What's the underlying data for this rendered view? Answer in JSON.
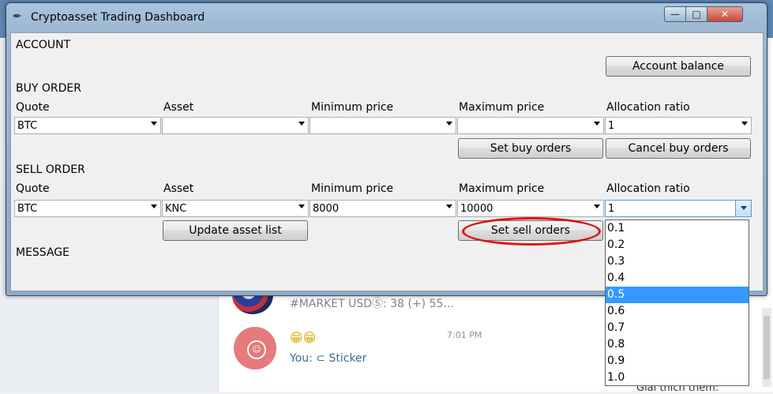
{
  "background": {
    "chat_preview": "#MARKET USDⓈ: 38 (+) 55...",
    "emoji": "😁😁",
    "time": "7:01 PM",
    "you_text": "You: ⊂ Sticker",
    "right_text": "Giai thich them:"
  },
  "window": {
    "title": "Cryptoasset Trading Dashboard",
    "controls": {
      "minimize": "—",
      "maximize": "□",
      "close": "✕"
    }
  },
  "account": {
    "heading": "ACCOUNT",
    "balance_button": "Account balance"
  },
  "buy": {
    "heading": "BUY ORDER",
    "labels": {
      "quote": "Quote",
      "asset": "Asset",
      "min": "Minimum price",
      "max": "Maximum price",
      "ratio": "Allocation ratio"
    },
    "values": {
      "quote": "BTC",
      "asset": "",
      "min": "",
      "max": "",
      "ratio": "1"
    },
    "set_button": "Set buy orders",
    "cancel_button": "Cancel buy orders"
  },
  "sell": {
    "heading": "SELL ORDER",
    "labels": {
      "quote": "Quote",
      "asset": "Asset",
      "min": "Minimum price",
      "max": "Maximum price",
      "ratio": "Allocation ratio"
    },
    "values": {
      "quote": "BTC",
      "asset": "KNC",
      "min": "8000",
      "max": "10000",
      "ratio": "1"
    },
    "update_button": "Update asset list",
    "set_button": "Set sell orders"
  },
  "message": {
    "heading": "MESSAGE"
  },
  "ratio_dropdown": {
    "options": [
      "0.1",
      "0.2",
      "0.3",
      "0.4",
      "0.5",
      "0.6",
      "0.7",
      "0.8",
      "0.9",
      "1.0"
    ],
    "selected": "0.5"
  },
  "colors": {
    "highlight": "#3399ff",
    "annotation": "#e01010"
  }
}
